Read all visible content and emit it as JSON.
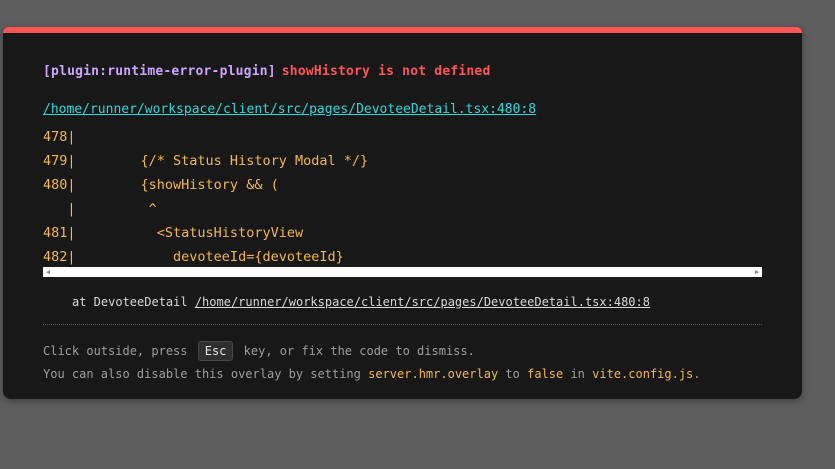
{
  "error": {
    "plugin": "[plugin:runtime-error-plugin]",
    "message": "showHistory is not defined",
    "file": "/home/runner/workspace/client/src/pages/DevoteeDetail.tsx:480:8"
  },
  "code_frame": [
    "478|",
    "479|        {/* Status History Modal */}",
    "480|        {showHistory && (",
    "   |         ^",
    "481|          <StatusHistoryView",
    "482|            devoteeId={devoteeId}"
  ],
  "stack": {
    "prefix": "at DevoteeDetail",
    "link": "/home/runner/workspace/client/src/pages/DevoteeDetail.tsx:480:8"
  },
  "tip": {
    "line1_before": "Click outside, press",
    "line1_key": "Esc",
    "line1_after": "key, or fix the code to dismiss.",
    "line2_a": "You can also disable this overlay by setting",
    "line2_setting": "server.hmr.overlay",
    "line2_b": "to",
    "line2_value": "false",
    "line2_c": "in",
    "line2_file": "vite.config.js",
    "line2_end": "."
  },
  "colors": {
    "accent": "#ff5555",
    "plugin": "#cfa4ff",
    "link": "#2dd9da",
    "code": "#f5b74b",
    "background": "#181818"
  }
}
